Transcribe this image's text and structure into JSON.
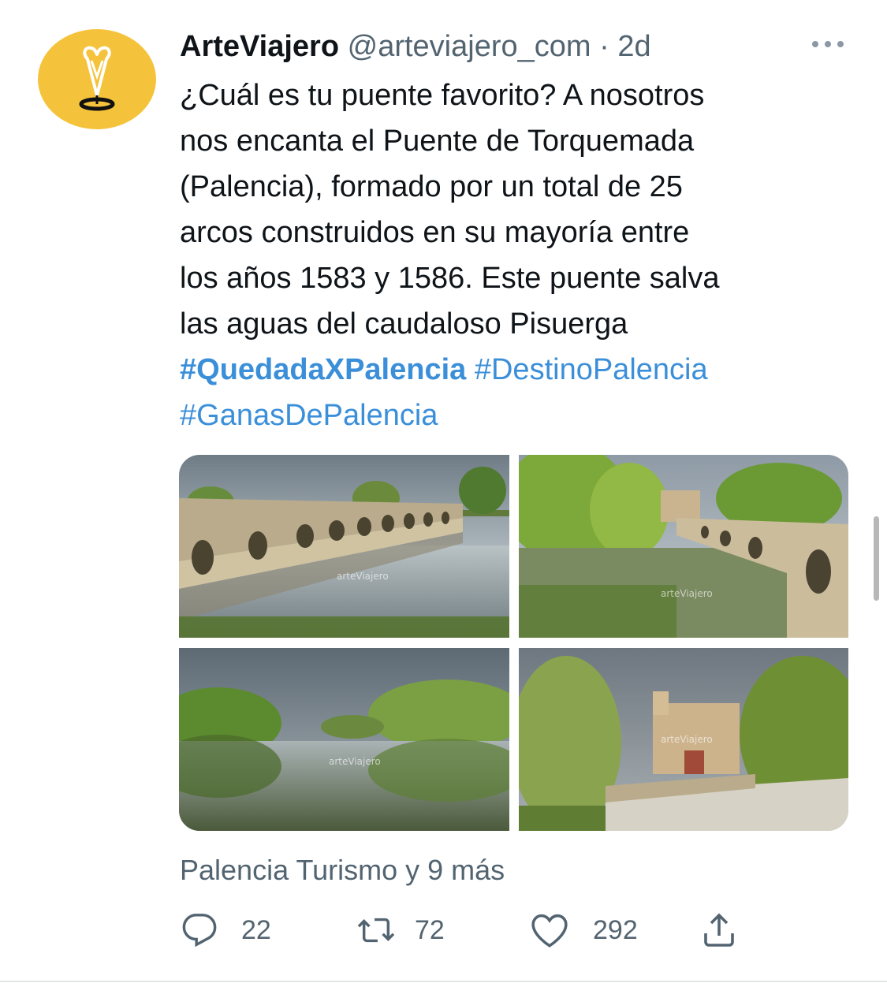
{
  "tweet": {
    "author_name": "ArteViajero",
    "handle": "@arteviajero_com",
    "separator": "·",
    "time": "2d",
    "avatar_icon": "arteviajero-logo-icon",
    "more_icon": "more-horizontal-icon",
    "text_lines": [
      "¿Cuál es tu puente favorito? A nosotros",
      "nos encanta el Puente de Torquemada",
      "(Palencia), formado por un total de 25",
      "arcos construidos en su mayoría entre",
      "los años 1583 y 1586. Este puente salva",
      "las aguas del caudaloso Pisuerga"
    ],
    "hashtags": [
      "#QuedadaXPalencia",
      "#DestinoPalencia",
      "#GanasDePalencia"
    ],
    "photos": [
      {
        "icon": "bridge-photo",
        "watermark": "arteViajero"
      },
      {
        "icon": "bridge-photo",
        "watermark": "arteViajero"
      },
      {
        "icon": "river-photo",
        "watermark": "arteViajero"
      },
      {
        "icon": "bridge-church-photo",
        "watermark": "arteViajero"
      }
    ],
    "tagged_text": "Palencia Turismo y 9 más",
    "actions": {
      "reply": {
        "icon": "reply-icon",
        "count": "22"
      },
      "retweet": {
        "icon": "retweet-icon",
        "count": "72"
      },
      "like": {
        "icon": "heart-icon",
        "count": "292"
      },
      "share": {
        "icon": "share-icon"
      }
    },
    "colors": {
      "text": "#0f1419",
      "secondary": "#536471",
      "link": "#3b8fd9",
      "avatar_bg": "#f5c33b"
    }
  }
}
